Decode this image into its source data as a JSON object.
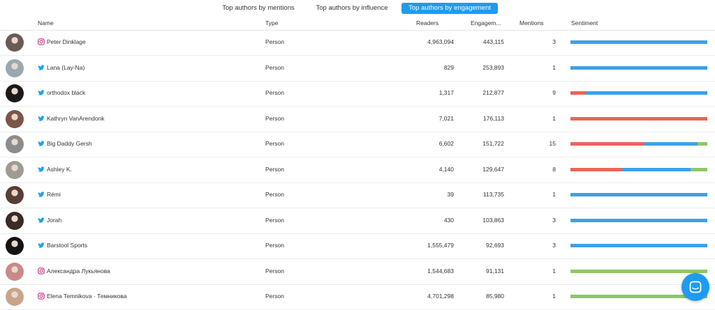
{
  "tabs": [
    {
      "label": "Top authors by mentions",
      "active": false
    },
    {
      "label": "Top authors by influence",
      "active": false
    },
    {
      "label": "Top authors by engagement",
      "active": true
    }
  ],
  "columns": {
    "name": "Name",
    "type": "Type",
    "readers": "Readers",
    "engagement": "Engagem...",
    "mentions": "Mentions",
    "sentiment": "Sentiment"
  },
  "colors": {
    "accent": "#1e9bf0",
    "negative": "#ec6458",
    "neutral": "#3ca0e8",
    "positive": "#8cc865",
    "twitter": "#1da1f2",
    "instagram": "#c13584"
  },
  "authors": [
    {
      "network": "instagram-icon",
      "name": "Peter Dinklage",
      "type": "Person",
      "readers": "4,963,094",
      "engagement": "443,115",
      "mentions": "3",
      "sentiment": {
        "negative": 0,
        "neutral": 1,
        "positive": 0
      },
      "avatar": "#6b5a55"
    },
    {
      "network": "twitter-icon",
      "name": "Lana (Lay-Na)",
      "type": "Person",
      "readers": "829",
      "engagement": "253,893",
      "mentions": "1",
      "sentiment": {
        "negative": 0,
        "neutral": 1,
        "positive": 0
      },
      "avatar": "#9aa8b0"
    },
    {
      "network": "twitter-icon",
      "name": "orthodox black",
      "type": "Person",
      "readers": "1,317",
      "engagement": "212,877",
      "mentions": "9",
      "sentiment": {
        "negative": 0.11,
        "neutral": 0.89,
        "positive": 0
      },
      "avatar": "#1a1a1a"
    },
    {
      "network": "twitter-icon",
      "name": "Kathryn VanArendonk",
      "type": "Person",
      "readers": "7,021",
      "engagement": "176,113",
      "mentions": "1",
      "sentiment": {
        "negative": 1,
        "neutral": 0,
        "positive": 0
      },
      "avatar": "#7a5648"
    },
    {
      "network": "twitter-icon",
      "name": "Big Daddy Gersh",
      "type": "Person",
      "readers": "6,602",
      "engagement": "151,722",
      "mentions": "15",
      "sentiment": {
        "negative": 0.53,
        "neutral": 0.4,
        "positive": 0.07
      },
      "avatar": "#8c8c8c"
    },
    {
      "network": "twitter-icon",
      "name": "Ashley K.",
      "type": "Person",
      "readers": "4,140",
      "engagement": "129,647",
      "mentions": "8",
      "sentiment": {
        "negative": 0.375,
        "neutral": 0.5,
        "positive": 0.125
      },
      "avatar": "#a09a95"
    },
    {
      "network": "twitter-icon",
      "name": "Rémi",
      "type": "Person",
      "readers": "39",
      "engagement": "113,735",
      "mentions": "1",
      "sentiment": {
        "negative": 0,
        "neutral": 1,
        "positive": 0
      },
      "avatar": "#5a3e36"
    },
    {
      "network": "twitter-icon",
      "name": "Jorah",
      "type": "Person",
      "readers": "430",
      "engagement": "103,863",
      "mentions": "3",
      "sentiment": {
        "negative": 0,
        "neutral": 1,
        "positive": 0
      },
      "avatar": "#3b2a25"
    },
    {
      "network": "twitter-icon",
      "name": "Barstool Sports",
      "type": "Person",
      "readers": "1,555,479",
      "engagement": "92,693",
      "mentions": "3",
      "sentiment": {
        "negative": 0,
        "neutral": 1,
        "positive": 0
      },
      "avatar": "#141414"
    },
    {
      "network": "instagram-icon",
      "name": "Александра Лукьянова",
      "type": "Person",
      "readers": "1,544,683",
      "engagement": "91,131",
      "mentions": "1",
      "sentiment": {
        "negative": 0,
        "neutral": 0,
        "positive": 1
      },
      "avatar": "#c98a86"
    },
    {
      "network": "instagram-icon",
      "name": "Elena Temnikova · Темникова",
      "type": "Person",
      "readers": "4,701,298",
      "engagement": "85,980",
      "mentions": "1",
      "sentiment": {
        "negative": 0,
        "neutral": 0,
        "positive": 1
      },
      "avatar": "#c7a48c"
    }
  ],
  "chat": {
    "icon": "chat-bubble-icon"
  }
}
